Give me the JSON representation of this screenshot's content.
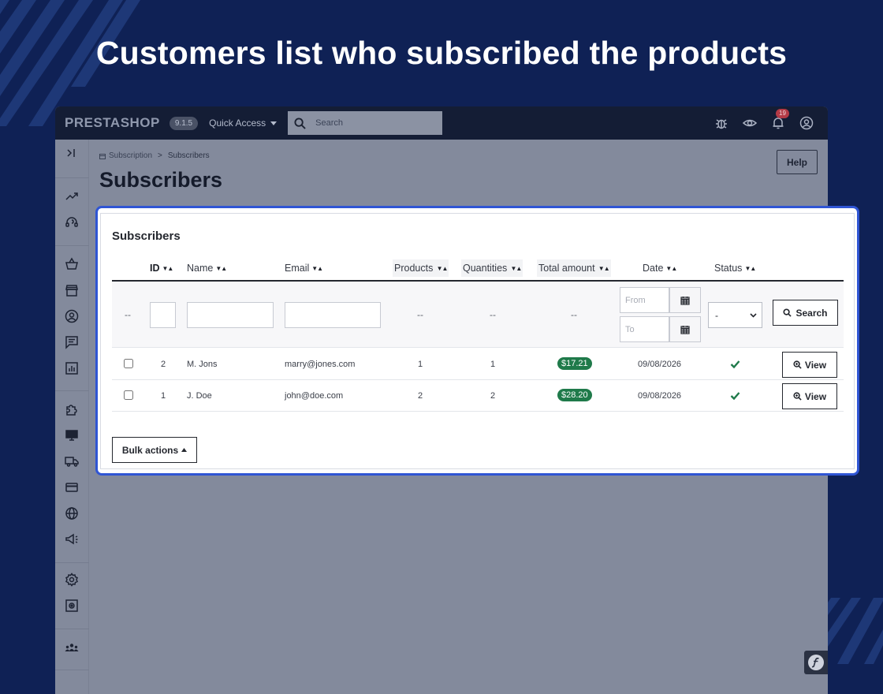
{
  "hero": {
    "title": "Customers list who subscribed the products"
  },
  "topbar": {
    "logo": "PRESTASHOP",
    "version": "9.1.5",
    "quick_access": "Quick Access",
    "search_placeholder": "Search",
    "notifications_count": "19",
    "icons": [
      "bug-icon",
      "eye-icon",
      "bell-icon",
      "user-circle-icon"
    ]
  },
  "sidebar": {
    "icons": [
      "collapse-icon",
      "trending-up-icon",
      "support-icon",
      "basket-icon",
      "store-icon",
      "customer-icon",
      "messages-icon",
      "stats-icon",
      "puzzle-icon",
      "monitor-icon",
      "truck-icon",
      "credit-card-icon",
      "globe-icon",
      "megaphone-icon",
      "gear-icon",
      "gear-square-icon",
      "team-icon"
    ]
  },
  "breadcrumb": {
    "parent": "Subscription",
    "separator": ">",
    "current": "Subscribers"
  },
  "page": {
    "title": "Subscribers",
    "help_label": "Help"
  },
  "card": {
    "title": "Subscribers",
    "columns": [
      "ID",
      "Name",
      "Email",
      "Products",
      "Quantities",
      "Total amount",
      "Date",
      "Status"
    ],
    "filters": {
      "dash": "--",
      "from_placeholder": "From",
      "to_placeholder": "To",
      "status_value": "-",
      "search_label": "Search"
    },
    "rows": [
      {
        "id": "2",
        "name": "M. Jons",
        "email": "marry@jones.com",
        "products": "1",
        "quantities": "1",
        "total": "$17.21",
        "date": "09/08/2026",
        "status": "active"
      },
      {
        "id": "1",
        "name": "J. Doe",
        "email": "john@doe.com",
        "products": "2",
        "quantities": "2",
        "total": "$28.20",
        "date": "09/08/2026",
        "status": "active"
      }
    ],
    "view_label": "View",
    "bulk_label": "Bulk actions"
  },
  "colors": {
    "background": "#0f2155",
    "highlight": "#2f55d4",
    "amount_badge": "#1f7a4a",
    "status_check": "#1f7a4a"
  }
}
